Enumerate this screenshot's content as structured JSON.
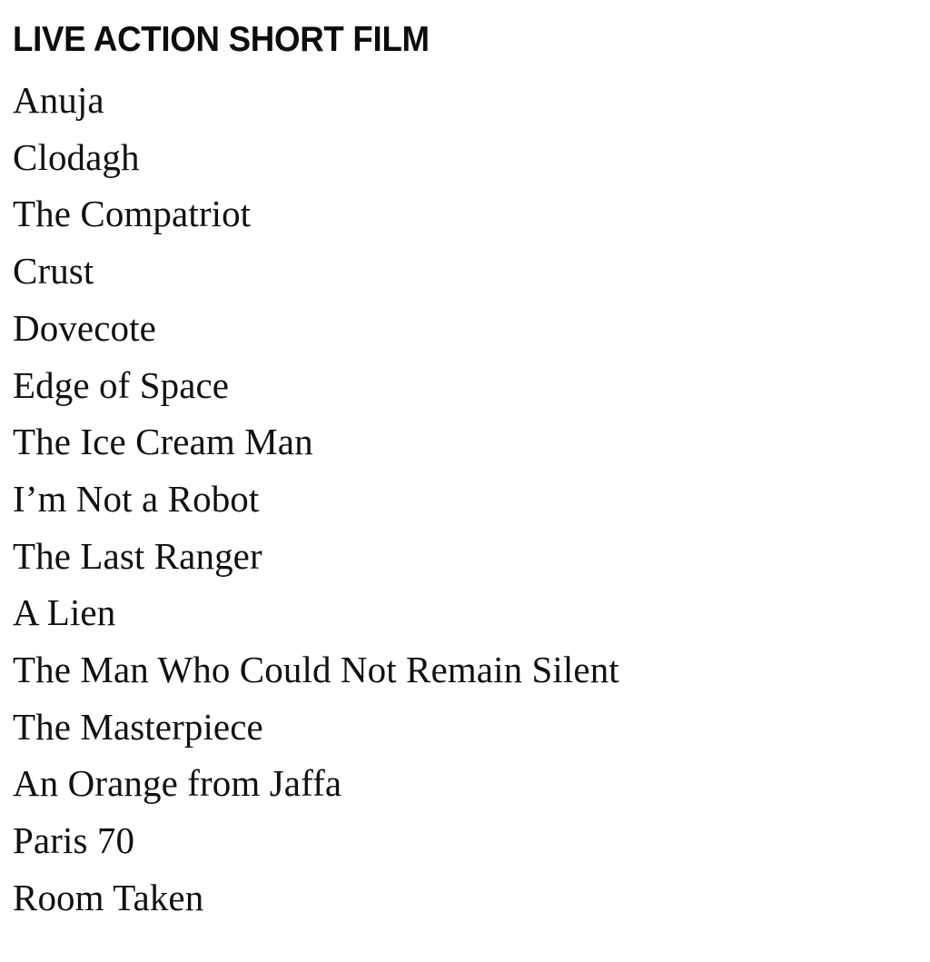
{
  "page": {
    "background_color": "#ffffff",
    "text_color": "#111111",
    "heading_color": "#0d0d0d"
  },
  "category": {
    "heading": "LIVE ACTION SHORT FILM",
    "nominees": [
      "Anuja",
      "Clodagh",
      "The Compatriot",
      "Crust",
      "Dovecote",
      "Edge of Space",
      "The Ice Cream Man",
      "I’m Not a Robot",
      "The Last Ranger",
      "A Lien",
      "The Man Who Could Not Remain Silent",
      "The Masterpiece",
      "An Orange from Jaffa",
      "Paris 70",
      "Room Taken"
    ]
  }
}
